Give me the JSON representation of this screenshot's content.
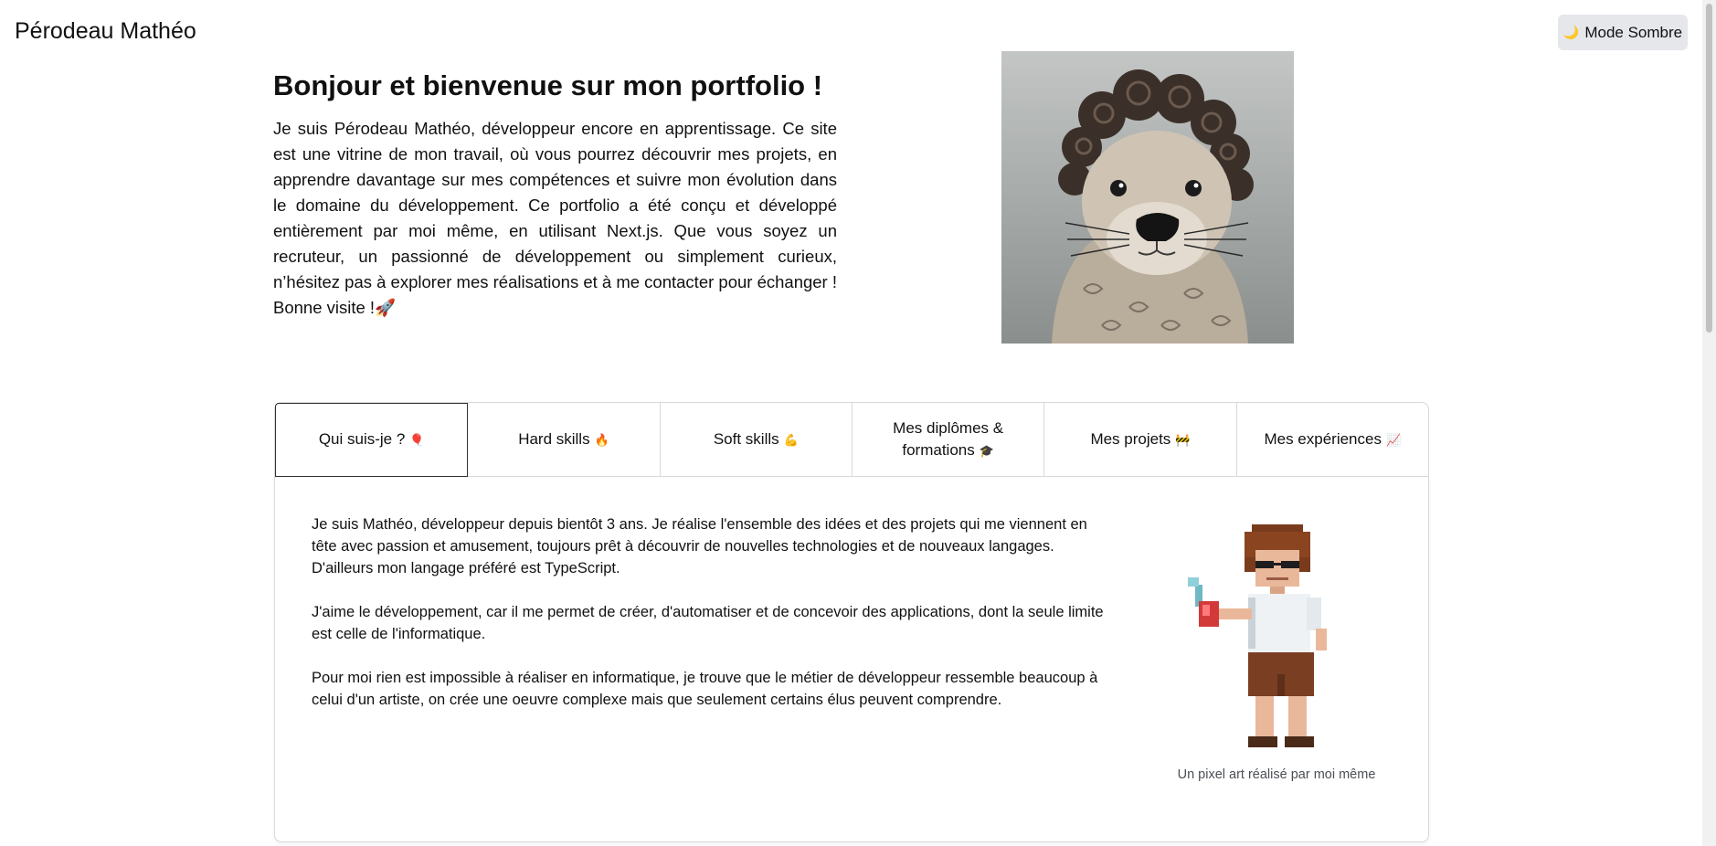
{
  "header": {
    "site_name": "Pérodeau Mathéo",
    "mode_button": {
      "icon": "moon-icon",
      "icon_glyph": "🌙",
      "label": "Mode Sombre"
    }
  },
  "hero": {
    "title": "Bonjour et bienvenue sur mon portfolio !",
    "text": "Je suis Pérodeau Mathéo, développeur encore en apprentissage. Ce site est une vitrine de mon travail, où vous pourrez découvrir mes projets, en apprendre davantage sur mes compétences et suivre mon évolution dans le domaine du développement. Ce portfolio a été conçu et développé entièrement par moi même, en utilisant Next.js. Que vous soyez un recruteur, un passionné de développement ou simplement curieux, n’hésitez pas à explorer mes réalisations et à me contacter pour échanger ! Bonne visite !",
    "text_emoji": "🚀",
    "portrait_icon": "curly-otter-portrait"
  },
  "tabs": [
    {
      "label": "Qui suis-je ?",
      "emoji": "🎈",
      "active": true
    },
    {
      "label": "Hard skills",
      "emoji": "🔥",
      "active": false
    },
    {
      "label": "Soft skills",
      "emoji": "💪",
      "active": false
    },
    {
      "label": "Mes diplômes & formations",
      "emoji": "🎓",
      "active": false
    },
    {
      "label": "Mes projets",
      "emoji": "🚧",
      "active": false
    },
    {
      "label": "Mes expériences",
      "emoji": "📈",
      "active": false
    }
  ],
  "panel": {
    "paragraphs": [
      "Je suis Mathéo, développeur depuis bientôt 3 ans. Je réalise l'ensemble des idées et des projets qui me viennent en tête avec passion et amusement, toujours prêt à découvrir de nouvelles technologies et de nouveaux langages. D'ailleurs mon langage préféré est TypeScript.",
      "J'aime le développement, car il me permet de créer, d'automatiser et de concevoir des applications, dont la seule limite est celle de l'informatique.",
      "Pour moi rien est impossible à réaliser en informatique, je trouve que le métier de développeur ressemble beaucoup à celui d'un artiste, on crée une oeuvre complexe mais que seulement certains élus peuvent comprendre."
    ],
    "image_icon": "pixel-art-character",
    "caption": "Un pixel art réalisé par moi même"
  },
  "colors": {
    "background": "#ffffff",
    "button_bg": "#e5e7eb",
    "border": "#d9d9d9",
    "active_tab_border": "#333333",
    "caption": "#4b4f55"
  }
}
